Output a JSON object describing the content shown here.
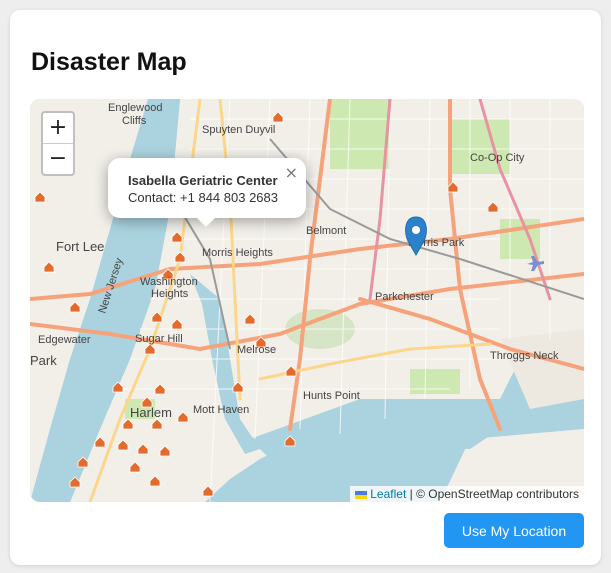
{
  "page": {
    "title": "Disaster Map"
  },
  "map": {
    "zoom_in_label": "+",
    "zoom_out_label": "−",
    "popup": {
      "name": "Isabella Geriatric Center",
      "contact": "Contact: +1 844 803 2683",
      "close_label": "×"
    },
    "attribution": {
      "leaflet_label": "Leaflet",
      "separator": " | © ",
      "osm_label": "OpenStreetMap contributors"
    },
    "place_labels": [
      "Englewood Cliffs",
      "Spuyten Duyvil",
      "Co-Op City",
      "Fort Lee",
      "Belmont",
      "Morris Park",
      "Morris Heights",
      "Washington Heights",
      "Parkchester",
      "Edgewater",
      "Sugar Hill",
      "Melrose",
      "Throggs Neck",
      "Harlem",
      "Mott Haven",
      "Hunts Point",
      "New Jersey",
      "Park"
    ],
    "colors": {
      "water": "#aad3df",
      "land": "#f2efe9",
      "park": "#cde8b0",
      "primary_road": "#f6a27a",
      "marker": "#2b82cb",
      "shelter_icon": "#e36b2c"
    }
  },
  "actions": {
    "locate_button": "Use My Location"
  }
}
